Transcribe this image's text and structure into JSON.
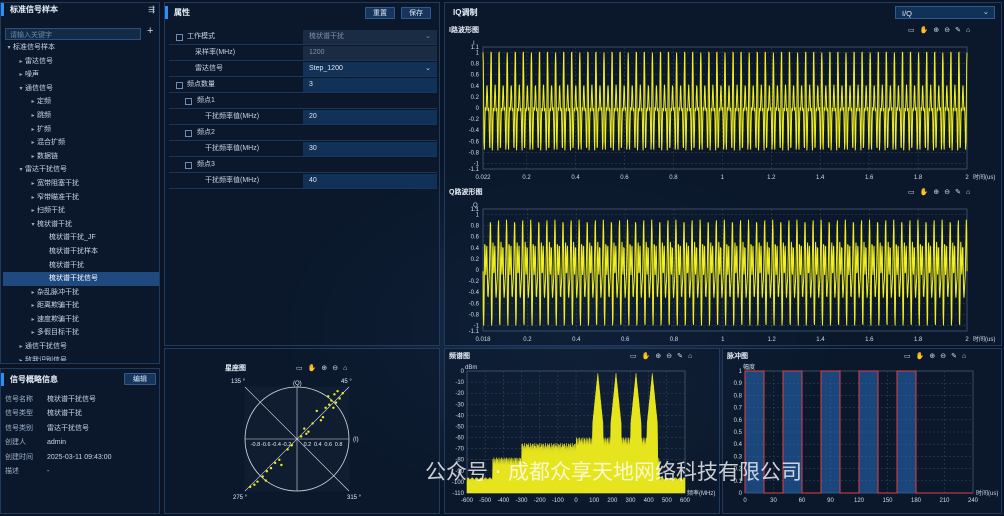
{
  "left_panel": {
    "title": "标准信号样本",
    "search_placeholder": "请输入关键字",
    "add": "+",
    "tree": [
      {
        "label": "标准信号样本",
        "lvl": 0,
        "arrow": "▾"
      },
      {
        "label": "雷达信号",
        "lvl": 1,
        "arrow": "▸"
      },
      {
        "label": "噪声",
        "lvl": 1,
        "arrow": "▸"
      },
      {
        "label": "通信信号",
        "lvl": 1,
        "arrow": "▾"
      },
      {
        "label": "定频",
        "lvl": 2,
        "arrow": "▸"
      },
      {
        "label": "跳频",
        "lvl": 2,
        "arrow": "▸"
      },
      {
        "label": "扩频",
        "lvl": 2,
        "arrow": "▸"
      },
      {
        "label": "混合扩频",
        "lvl": 2,
        "arrow": "▸"
      },
      {
        "label": "数据链",
        "lvl": 2,
        "arrow": "▸"
      },
      {
        "label": "雷达干扰信号",
        "lvl": 1,
        "arrow": "▾"
      },
      {
        "label": "宽带阻塞干扰",
        "lvl": 2,
        "arrow": "▸"
      },
      {
        "label": "窄带瞄准干扰",
        "lvl": 2,
        "arrow": "▸"
      },
      {
        "label": "扫频干扰",
        "lvl": 2,
        "arrow": "▸"
      },
      {
        "label": "梳状谱干扰",
        "lvl": 2,
        "arrow": "▾"
      },
      {
        "label": "梳状谱干扰_JF",
        "lvl": 3,
        "arrow": ""
      },
      {
        "label": "梳状谱干扰样本",
        "lvl": 3,
        "arrow": ""
      },
      {
        "label": "梳状谱干扰",
        "lvl": 3,
        "arrow": ""
      },
      {
        "label": "梳状谱干扰信号",
        "lvl": 3,
        "arrow": "",
        "sel": true
      },
      {
        "label": "杂乱脉冲干扰",
        "lvl": 2,
        "arrow": "▸"
      },
      {
        "label": "距离欺骗干扰",
        "lvl": 2,
        "arrow": "▸"
      },
      {
        "label": "速度欺骗干扰",
        "lvl": 2,
        "arrow": "▸"
      },
      {
        "label": "多假目标干扰",
        "lvl": 2,
        "arrow": "▸"
      },
      {
        "label": "通信干扰信号",
        "lvl": 1,
        "arrow": "▸"
      },
      {
        "label": "敌我识别信号",
        "lvl": 1,
        "arrow": "▸"
      }
    ]
  },
  "info_panel": {
    "title": "信号概略信息",
    "edit": "编辑",
    "rows": [
      {
        "k": "信号名称",
        "v": "梳状谱干扰信号"
      },
      {
        "k": "信号类型",
        "v": "梳状谱干扰"
      },
      {
        "k": "信号类别",
        "v": "雷达干扰信号"
      },
      {
        "k": "创建人",
        "v": "admin"
      },
      {
        "k": "创建时间",
        "v": "2025-03-11 09:43:00"
      },
      {
        "k": "描述",
        "v": "-"
      }
    ]
  },
  "props": {
    "title": "属性",
    "reset": "重置",
    "save": "保存",
    "work_mode_label": "工作模式",
    "work_mode_value": "梳状谱干扰",
    "sample_rate_label": "采样率(MHz)",
    "sample_rate_value": "1200",
    "radar_signal_label": "雷达信号",
    "radar_signal_value": "Step_1200",
    "freq_count_label": "频点数量",
    "freq_count_value": "3",
    "freq1_label": "频点1",
    "freq1_jam_label": "干扰频率值(MHz)",
    "freq1_jam_value": "20",
    "freq2_label": "频点2",
    "freq2_jam_label": "干扰频率值(MHz)",
    "freq2_jam_value": "30",
    "freq3_label": "频点3",
    "freq3_jam_label": "干扰频率值(MHz)",
    "freq3_jam_value": "40"
  },
  "iq": {
    "title": "IQ调制",
    "select": "I/Q",
    "i_title": "I路波形图",
    "q_title": "Q路波形图",
    "spec_title": "频谱图",
    "pulse_title": "脉冲图",
    "const_title": "星座图"
  },
  "chart_data": [
    {
      "type": "line",
      "name": "i_wave",
      "title": "I路波形图",
      "xlabel": "时间(us)",
      "ylabel": "I",
      "xlim": [
        0.022,
        2
      ],
      "ylim": [
        -1.1,
        1.1
      ],
      "xticks": [
        "0.022",
        "0.2",
        "0.4",
        "0.6",
        "0.8",
        "1",
        "1.2",
        "1.4",
        "1.6",
        "1.8",
        "2"
      ],
      "yticks": [
        "1.1",
        "1",
        "0.8",
        "0.6",
        "0.4",
        "0.2",
        "0",
        "-0.2",
        "-0.4",
        "-0.6",
        "-0.8",
        "-1",
        "-1.1"
      ],
      "color": "#f2ef1c"
    },
    {
      "type": "line",
      "name": "q_wave",
      "title": "Q路波形图",
      "xlabel": "时间(us)",
      "ylabel": "Q",
      "xlim": [
        0.018,
        2
      ],
      "ylim": [
        -1.1,
        1.1
      ],
      "xticks": [
        "0.018",
        "0.2",
        "0.4",
        "0.6",
        "0.8",
        "1",
        "1.2",
        "1.4",
        "1.6",
        "1.8",
        "2"
      ],
      "yticks": [
        "1.1",
        "1",
        "0.8",
        "0.6",
        "0.4",
        "0.2",
        "0",
        "-0.2",
        "-0.4",
        "-0.6",
        "-0.8",
        "-1",
        "-1.1"
      ],
      "color": "#f2ef1c"
    },
    {
      "type": "area",
      "name": "spectrum",
      "title": "频谱图",
      "xlabel": "频率(MHz)",
      "ylabel": "dBm",
      "xlim": [
        -600,
        600
      ],
      "ylim": [
        -110,
        0
      ],
      "xticks": [
        "-600",
        "-500",
        "-400",
        "-300",
        "-200",
        "-100",
        "0",
        "100",
        "200",
        "300",
        "400",
        "500",
        "600"
      ],
      "yticks": [
        "0",
        "-10",
        "-20",
        "-30",
        "-40",
        "-50",
        "-60",
        "-70",
        "-80",
        "-90",
        "-100",
        "-110"
      ],
      "peaks_mhz": [
        120,
        220,
        330,
        420
      ],
      "color": "#f2ef1c"
    },
    {
      "type": "line",
      "name": "pulse",
      "title": "脉冲图",
      "xlabel": "时间(us)",
      "ylabel": "幅度",
      "xlim": [
        0,
        240
      ],
      "ylim": [
        0,
        1
      ],
      "xticks": [
        "0",
        "30",
        "60",
        "90",
        "120",
        "150",
        "180",
        "210",
        "240"
      ],
      "yticks": [
        "1",
        "0.9",
        "0.8",
        "0.7",
        "0.6",
        "0.5",
        "0.4",
        "0.3",
        "0.2",
        "0.1",
        "0"
      ],
      "pulses": [
        [
          0,
          20
        ],
        [
          40,
          60
        ],
        [
          80,
          100
        ],
        [
          120,
          140
        ],
        [
          160,
          180
        ]
      ],
      "color": "#e04040"
    },
    {
      "type": "scatter",
      "name": "constellation",
      "title": "星座图",
      "angle_labels": [
        "135 °",
        "45 °",
        "275 °",
        "315 °"
      ],
      "axis_labels": [
        "(Q)",
        "(I)"
      ],
      "ticks": [
        "-0.8",
        "-0.6",
        "-0.4",
        "-0.2",
        "0.2",
        "0.4",
        "0.6",
        "0.8"
      ]
    }
  ],
  "watermark": "公众号 · 成都众享天地网络科技有限公司"
}
